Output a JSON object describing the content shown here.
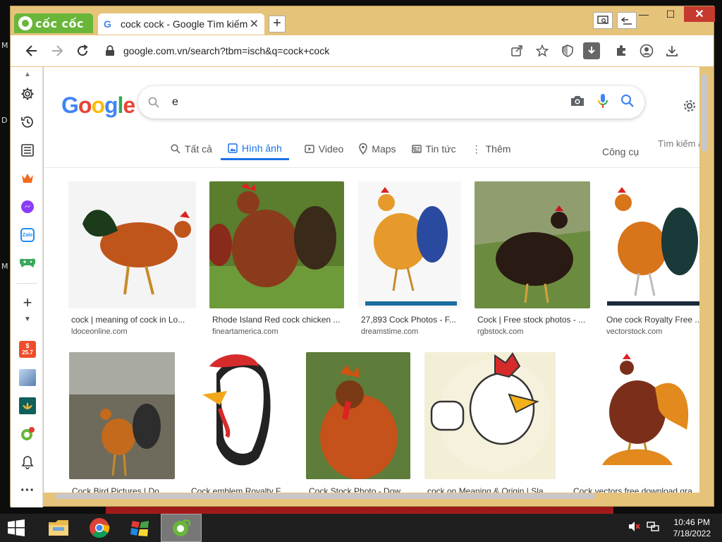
{
  "desktop": {
    "edge_letters": [
      "M",
      "D",
      "M"
    ]
  },
  "browser": {
    "brand": "cốc cốc",
    "tab": {
      "title": "cock cock - Google Tìm kiếm",
      "close": "✕"
    },
    "new_tab": "+",
    "window_controls": {
      "minimize": "—",
      "maximize": "☐",
      "close": "✕"
    },
    "address": "google.com.vn/search?tbm=isch&q=cock+cock"
  },
  "google": {
    "logo": [
      "G",
      "o",
      "o",
      "g",
      "l",
      "e"
    ],
    "query": "e",
    "tabs": [
      {
        "label": "Tất cả",
        "icon": "search-icon"
      },
      {
        "label": "Hình ảnh",
        "icon": "image-icon",
        "active": true
      },
      {
        "label": "Video",
        "icon": "video-icon"
      },
      {
        "label": "Maps",
        "icon": "map-pin-icon"
      },
      {
        "label": "Tin tức",
        "icon": "news-icon"
      },
      {
        "label": "Thêm",
        "icon": "more-icon"
      }
    ],
    "tools": "Công cụ",
    "safe_search": "Tìm kiếm an"
  },
  "results": [
    {
      "caption": "cock | meaning of cock in Lo...",
      "source": "ldoceonline.com",
      "colors": [
        "#f4f4f4",
        "#c0551c",
        "#1b3b1b"
      ]
    },
    {
      "caption": "Rhode Island Red cock chicken ...",
      "source": "fineartamerica.com",
      "colors": [
        "#5a7d2e",
        "#8a3b1b",
        "#3a2a1a"
      ]
    },
    {
      "caption": "27,893 Cock Photos - F...",
      "source": "dreamstime.com",
      "colors": [
        "#f7f7f7",
        "#e69a2c",
        "#2a4aa0"
      ]
    },
    {
      "caption": "Cock | Free stock photos - ...",
      "source": "rgbstock.com",
      "colors": [
        "#6b8c3e",
        "#2a1a14",
        "#b5b0a0"
      ]
    },
    {
      "caption": "One cock Royalty Free ...",
      "source": "vectorstock.com",
      "colors": [
        "#ffffff",
        "#d8741a",
        "#1a3a3a"
      ]
    },
    {
      "caption": "Cock Bird Pictures | Do...",
      "source": "",
      "colors": [
        "#6e6a5c",
        "#c36a1c",
        "#2d2d2d"
      ]
    },
    {
      "caption": "Cock emblem Royalty F...",
      "source": "",
      "colors": [
        "#ffffff",
        "#d52b2b",
        "#222222"
      ]
    },
    {
      "caption": "Cock Stock Photo - Dow...",
      "source": "",
      "colors": [
        "#5e7c3a",
        "#c5521a",
        "#7a3a15"
      ]
    },
    {
      "caption": "cock on Meaning & Origin | Sla...",
      "source": "",
      "colors": [
        "#f3eed6",
        "#ffffff",
        "#d52b2b"
      ]
    },
    {
      "caption": "Cock vectors free download gra...",
      "source": "",
      "colors": [
        "#ffffff",
        "#7b2f1a",
        "#e28a1e"
      ]
    }
  ],
  "taskbar": {
    "time": "10:46 PM",
    "date": "7/18/2022"
  },
  "sidebar_badge": "25.7"
}
